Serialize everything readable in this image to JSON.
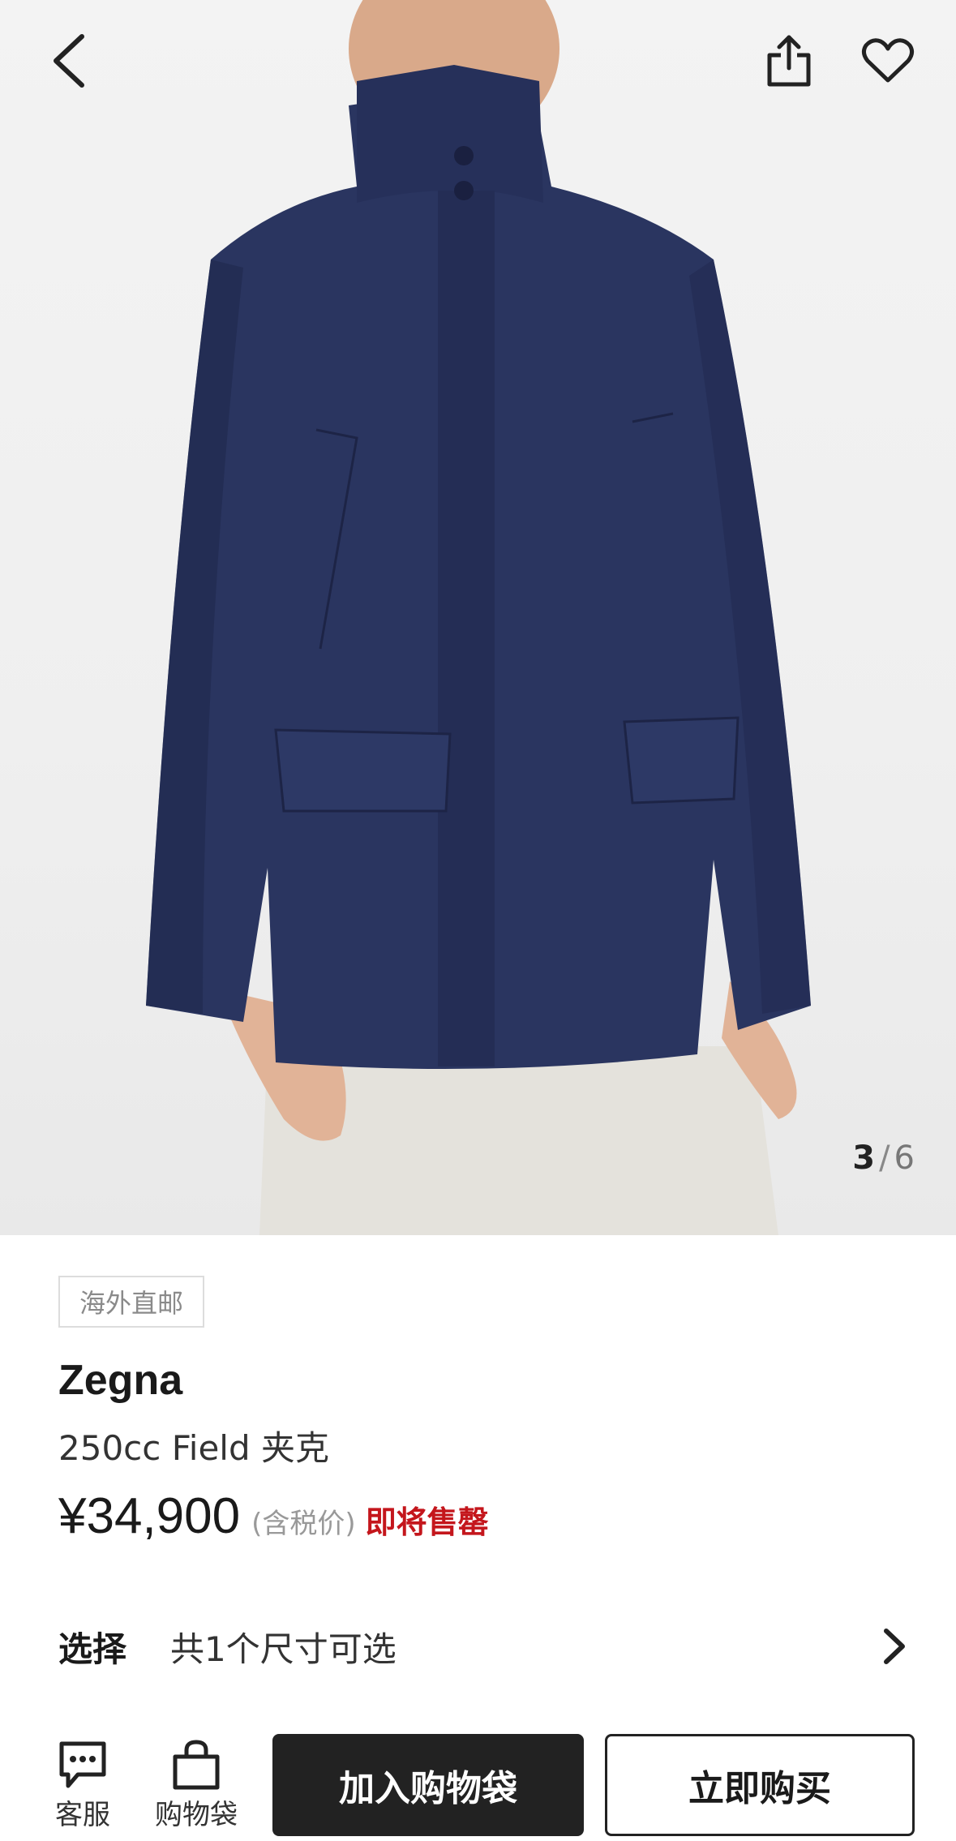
{
  "gallery": {
    "current": "3",
    "separator": "/",
    "total": "6"
  },
  "header": {
    "back_icon": "chevron-left-icon",
    "share_icon": "share-icon",
    "favorite_icon": "heart-icon"
  },
  "product": {
    "tag": "海外直邮",
    "brand": "Zegna",
    "name": "250cc Field 夹克",
    "price": "¥34,900",
    "tax_note": "(含税价)",
    "stock_note": "即将售罄",
    "stock_color": "#c4161c"
  },
  "selection": {
    "label": "选择",
    "value": "共1个尺寸可选",
    "arrow_icon": "chevron-right-icon"
  },
  "bottom_bar": {
    "customer_service_label": "客服",
    "customer_service_icon": "chat-bubble-icon",
    "bag_label": "购物袋",
    "bag_icon": "shopping-bag-icon",
    "add_to_bag_label": "加入购物袋",
    "buy_now_label": "立即购买"
  }
}
